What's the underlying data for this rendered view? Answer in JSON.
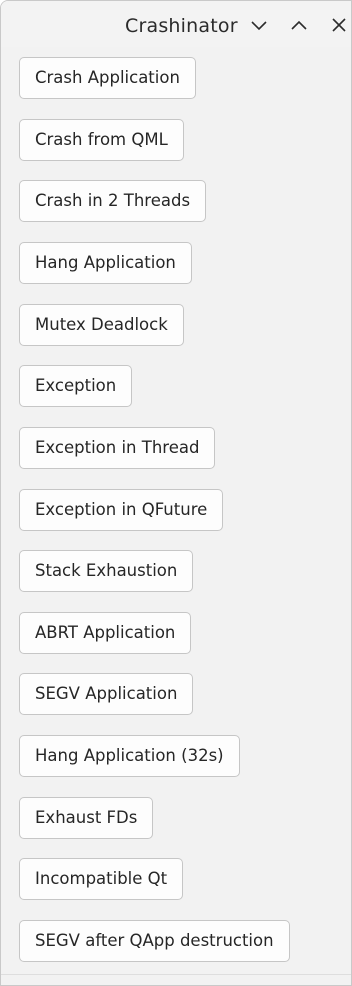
{
  "window": {
    "title": "Crashinator",
    "controls": {
      "minimize_icon": "chevron-down-icon",
      "maximize_icon": "chevron-up-icon",
      "close_icon": "close-icon"
    }
  },
  "buttons": [
    {
      "id": "crash-application",
      "label": "Crash Application"
    },
    {
      "id": "crash-from-qml",
      "label": "Crash from QML"
    },
    {
      "id": "crash-in-2-threads",
      "label": "Crash in 2 Threads"
    },
    {
      "id": "hang-application",
      "label": "Hang Application"
    },
    {
      "id": "mutex-deadlock",
      "label": "Mutex Deadlock"
    },
    {
      "id": "exception",
      "label": "Exception"
    },
    {
      "id": "exception-in-thread",
      "label": "Exception in Thread"
    },
    {
      "id": "exception-in-qfuture",
      "label": "Exception in QFuture"
    },
    {
      "id": "stack-exhaustion",
      "label": "Stack Exhaustion"
    },
    {
      "id": "abrt-application",
      "label": "ABRT Application"
    },
    {
      "id": "segv-application",
      "label": "SEGV Application"
    },
    {
      "id": "hang-application-32s",
      "label": "Hang Application (32s)"
    },
    {
      "id": "exhaust-fds",
      "label": "Exhaust FDs"
    },
    {
      "id": "incompatible-qt",
      "label": "Incompatible Qt"
    },
    {
      "id": "segv-after-qapp-destruction",
      "label": "SEGV after QApp destruction"
    }
  ]
}
